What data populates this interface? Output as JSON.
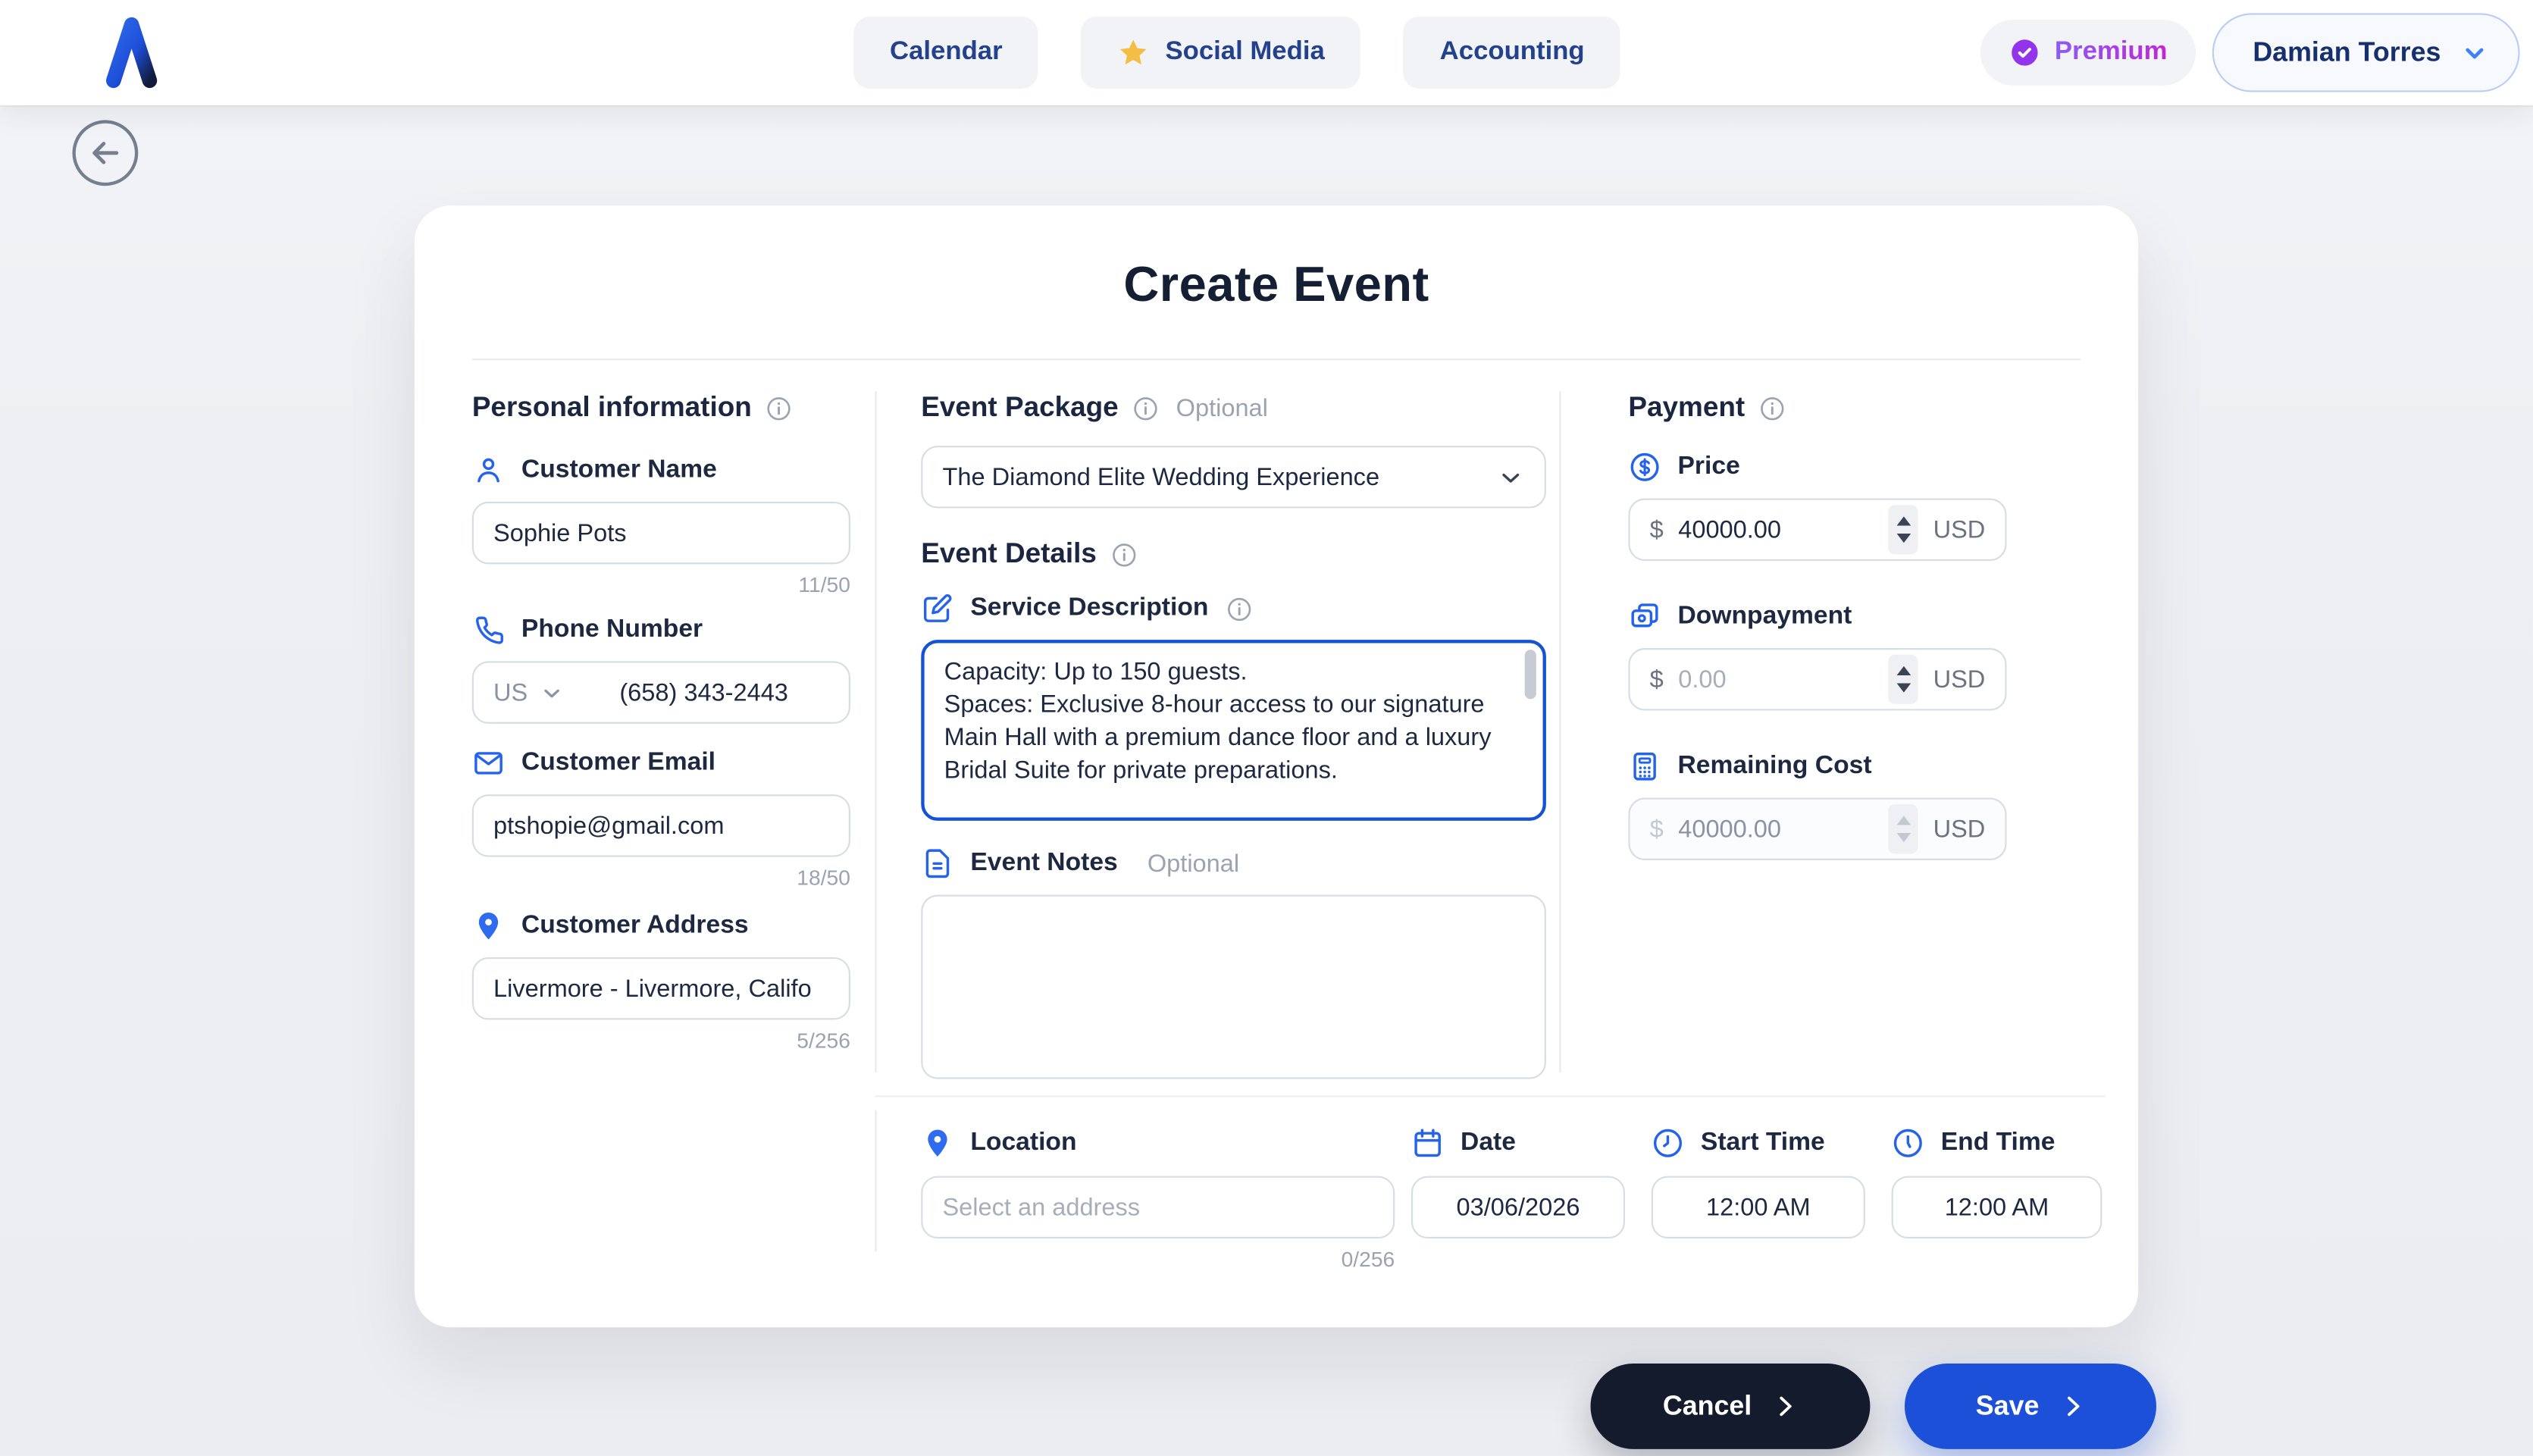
{
  "colors": {
    "accent_blue": "#2563eb",
    "focus_blue": "#1553d6",
    "navy": "#1b2740",
    "nav_text": "#24418c",
    "premium_purple": "#9333ea",
    "star_yellow": "#f6bd45",
    "save_blue": "#1d50d8",
    "cancel_navy": "#141b2d"
  },
  "header": {
    "nav": [
      {
        "label": "Calendar"
      },
      {
        "label": "Social Media"
      },
      {
        "label": "Accounting"
      }
    ],
    "premium_label": "Premium",
    "user_name": "Damian Torres"
  },
  "page": {
    "title": "Create Event"
  },
  "personal": {
    "section_title": "Personal information",
    "name": {
      "label": "Customer Name",
      "value": "Sophie Pots",
      "counter": "11/50"
    },
    "phone": {
      "label": "Phone Number",
      "country": "US",
      "value": "(658) 343-2443"
    },
    "email": {
      "label": "Customer Email",
      "value": "ptshopie@gmail.com",
      "counter": "18/50"
    },
    "address": {
      "label": "Customer Address",
      "value": "Livermore - Livermore, Califo",
      "counter": "5/256"
    }
  },
  "package": {
    "title": "Event Package",
    "optional": "Optional",
    "selected": "The Diamond Elite Wedding Experience"
  },
  "details": {
    "title": "Event Details",
    "service": {
      "label": "Service Description",
      "value": "Capacity: Up to 150 guests.\nSpaces: Exclusive 8-hour access to our signature Main Hall with a premium dance floor and a luxury Bridal Suite for private preparations."
    },
    "notes": {
      "label": "Event Notes",
      "optional": "Optional",
      "value": ""
    }
  },
  "payment": {
    "title": "Payment",
    "currency": "USD",
    "currency_symbol": "$",
    "price": {
      "label": "Price",
      "value": "40000.00"
    },
    "downpayment": {
      "label": "Downpayment",
      "placeholder": "0.00"
    },
    "remaining": {
      "label": "Remaining Cost",
      "value": "40000.00"
    }
  },
  "schedule": {
    "location": {
      "label": "Location",
      "placeholder": "Select an address",
      "counter": "0/256"
    },
    "date": {
      "label": "Date",
      "value": "03/06/2026"
    },
    "start": {
      "label": "Start Time",
      "value": "12:00 AM"
    },
    "end": {
      "label": "End Time",
      "value": "12:00 AM"
    }
  },
  "actions": {
    "cancel": "Cancel",
    "save": "Save"
  }
}
